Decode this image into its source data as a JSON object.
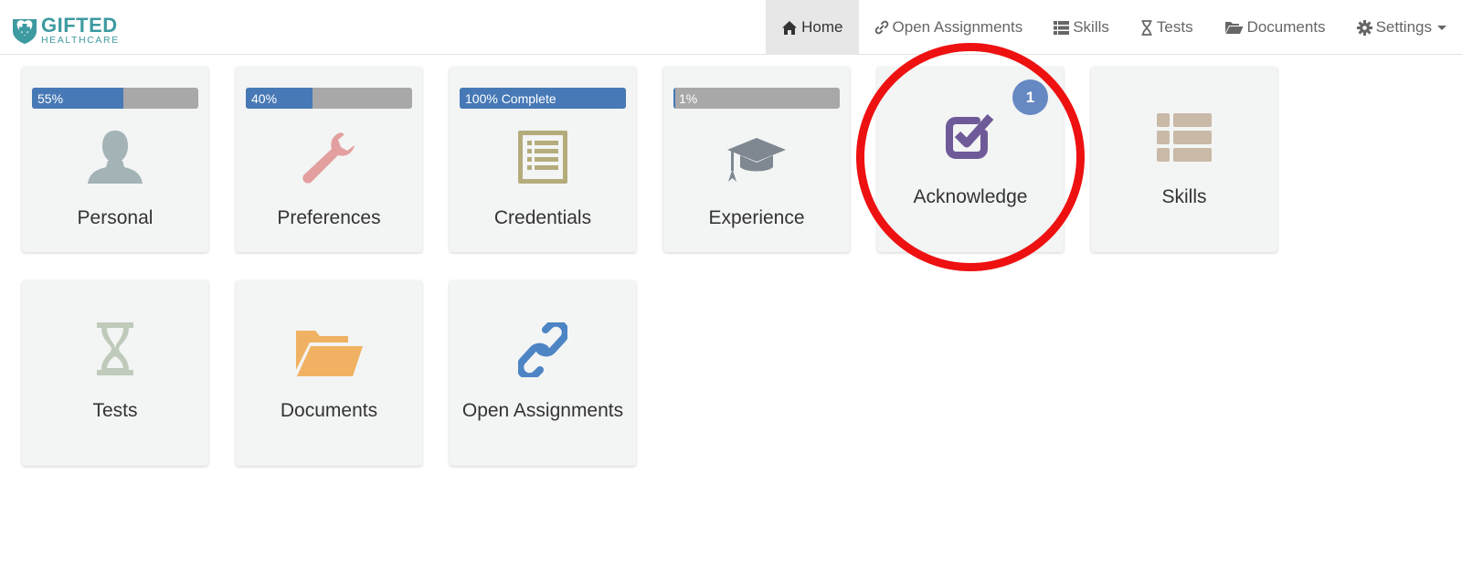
{
  "brand": {
    "name_line1": "GIFTED",
    "name_line2": "HEALTHCARE",
    "color": "#3d9aa1"
  },
  "nav": {
    "items": [
      {
        "label": "Home",
        "icon": "home-icon",
        "active": true
      },
      {
        "label": "Open Assignments",
        "icon": "link-icon"
      },
      {
        "label": "Skills",
        "icon": "list-icon"
      },
      {
        "label": "Tests",
        "icon": "hourglass-icon"
      },
      {
        "label": "Documents",
        "icon": "folder-open-icon"
      },
      {
        "label": "Settings",
        "icon": "gear-icon",
        "dropdown": true
      }
    ]
  },
  "tiles": [
    {
      "label": "Personal",
      "icon": "user-icon",
      "progress": 0.55,
      "progress_label": "55%"
    },
    {
      "label": "Preferences",
      "icon": "wrench-icon",
      "progress": 0.4,
      "progress_label": "40%"
    },
    {
      "label": "Credentials",
      "icon": "list-alt-icon",
      "progress": 1.0,
      "progress_label": "100% Complete"
    },
    {
      "label": "Experience",
      "icon": "graduation-cap-icon",
      "progress": 0.01,
      "progress_label": "1%"
    },
    {
      "label": "Acknowledge",
      "icon": "check-square-icon",
      "badge": "1",
      "highlighted": true
    },
    {
      "label": "Skills",
      "icon": "th-list-icon"
    },
    {
      "label": "Tests",
      "icon": "hourglass-icon"
    },
    {
      "label": "Documents",
      "icon": "folder-open-icon"
    },
    {
      "label": "Open Assignments",
      "icon": "link-icon"
    }
  ],
  "colors": {
    "progress_fill": "#4779b6",
    "progress_track": "#a8a8a8",
    "badge": "#6688c3",
    "highlight": "#ee1111",
    "icon_personal": "#a3b3b6",
    "icon_preferences": "#e39f9f",
    "icon_credentials": "#b5ac7c",
    "icon_experience": "#7f8791",
    "icon_acknowledge": "#6e5a98",
    "icon_skills": "#c9b9a7",
    "icon_tests": "#bfcabb",
    "icon_documents": "#f0b262",
    "icon_assignments": "#4c84c4"
  }
}
